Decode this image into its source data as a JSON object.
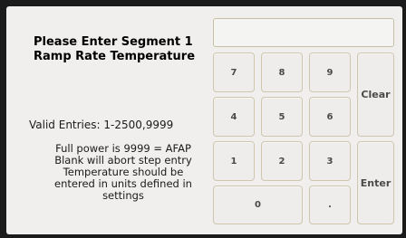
{
  "prompt": {
    "title_line1": "Please Enter Segment 1",
    "title_line2": "Ramp Rate Temperature"
  },
  "valid_entries": "Valid Entries: 1-2500,9999",
  "info_lines": [
    "Full power is 9999 = AFAP",
    "Blank will abort step entry",
    "Temperature should be",
    "entered in units defined in",
    "settings"
  ],
  "display": {
    "value": ""
  },
  "keypad": {
    "keys": [
      "7",
      "8",
      "9",
      "4",
      "5",
      "6",
      "1",
      "2",
      "3",
      "0",
      "."
    ],
    "clear_label": "Clear",
    "enter_label": "Enter"
  },
  "colors": {
    "background": "#f0efed",
    "key_face": "#eeedeb",
    "key_border": "#cfc6b0",
    "bezel": "#1b1b1b"
  }
}
